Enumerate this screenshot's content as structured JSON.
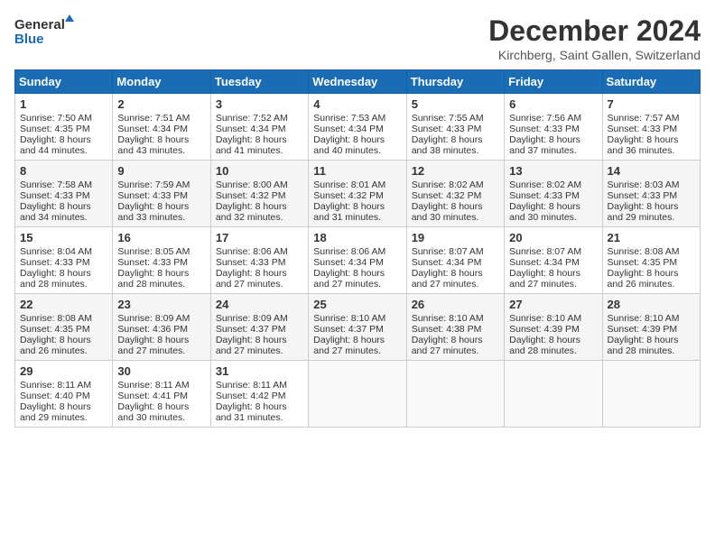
{
  "header": {
    "logo_line1": "General",
    "logo_line2": "Blue",
    "month_title": "December 2024",
    "location": "Kirchberg, Saint Gallen, Switzerland"
  },
  "days_of_week": [
    "Sunday",
    "Monday",
    "Tuesday",
    "Wednesday",
    "Thursday",
    "Friday",
    "Saturday"
  ],
  "weeks": [
    [
      {
        "day": "1",
        "sunrise": "Sunrise: 7:50 AM",
        "sunset": "Sunset: 4:35 PM",
        "daylight": "Daylight: 8 hours and 44 minutes."
      },
      {
        "day": "2",
        "sunrise": "Sunrise: 7:51 AM",
        "sunset": "Sunset: 4:34 PM",
        "daylight": "Daylight: 8 hours and 43 minutes."
      },
      {
        "day": "3",
        "sunrise": "Sunrise: 7:52 AM",
        "sunset": "Sunset: 4:34 PM",
        "daylight": "Daylight: 8 hours and 41 minutes."
      },
      {
        "day": "4",
        "sunrise": "Sunrise: 7:53 AM",
        "sunset": "Sunset: 4:34 PM",
        "daylight": "Daylight: 8 hours and 40 minutes."
      },
      {
        "day": "5",
        "sunrise": "Sunrise: 7:55 AM",
        "sunset": "Sunset: 4:33 PM",
        "daylight": "Daylight: 8 hours and 38 minutes."
      },
      {
        "day": "6",
        "sunrise": "Sunrise: 7:56 AM",
        "sunset": "Sunset: 4:33 PM",
        "daylight": "Daylight: 8 hours and 37 minutes."
      },
      {
        "day": "7",
        "sunrise": "Sunrise: 7:57 AM",
        "sunset": "Sunset: 4:33 PM",
        "daylight": "Daylight: 8 hours and 36 minutes."
      }
    ],
    [
      {
        "day": "8",
        "sunrise": "Sunrise: 7:58 AM",
        "sunset": "Sunset: 4:33 PM",
        "daylight": "Daylight: 8 hours and 34 minutes."
      },
      {
        "day": "9",
        "sunrise": "Sunrise: 7:59 AM",
        "sunset": "Sunset: 4:33 PM",
        "daylight": "Daylight: 8 hours and 33 minutes."
      },
      {
        "day": "10",
        "sunrise": "Sunrise: 8:00 AM",
        "sunset": "Sunset: 4:32 PM",
        "daylight": "Daylight: 8 hours and 32 minutes."
      },
      {
        "day": "11",
        "sunrise": "Sunrise: 8:01 AM",
        "sunset": "Sunset: 4:32 PM",
        "daylight": "Daylight: 8 hours and 31 minutes."
      },
      {
        "day": "12",
        "sunrise": "Sunrise: 8:02 AM",
        "sunset": "Sunset: 4:32 PM",
        "daylight": "Daylight: 8 hours and 30 minutes."
      },
      {
        "day": "13",
        "sunrise": "Sunrise: 8:02 AM",
        "sunset": "Sunset: 4:33 PM",
        "daylight": "Daylight: 8 hours and 30 minutes."
      },
      {
        "day": "14",
        "sunrise": "Sunrise: 8:03 AM",
        "sunset": "Sunset: 4:33 PM",
        "daylight": "Daylight: 8 hours and 29 minutes."
      }
    ],
    [
      {
        "day": "15",
        "sunrise": "Sunrise: 8:04 AM",
        "sunset": "Sunset: 4:33 PM",
        "daylight": "Daylight: 8 hours and 28 minutes."
      },
      {
        "day": "16",
        "sunrise": "Sunrise: 8:05 AM",
        "sunset": "Sunset: 4:33 PM",
        "daylight": "Daylight: 8 hours and 28 minutes."
      },
      {
        "day": "17",
        "sunrise": "Sunrise: 8:06 AM",
        "sunset": "Sunset: 4:33 PM",
        "daylight": "Daylight: 8 hours and 27 minutes."
      },
      {
        "day": "18",
        "sunrise": "Sunrise: 8:06 AM",
        "sunset": "Sunset: 4:34 PM",
        "daylight": "Daylight: 8 hours and 27 minutes."
      },
      {
        "day": "19",
        "sunrise": "Sunrise: 8:07 AM",
        "sunset": "Sunset: 4:34 PM",
        "daylight": "Daylight: 8 hours and 27 minutes."
      },
      {
        "day": "20",
        "sunrise": "Sunrise: 8:07 AM",
        "sunset": "Sunset: 4:34 PM",
        "daylight": "Daylight: 8 hours and 27 minutes."
      },
      {
        "day": "21",
        "sunrise": "Sunrise: 8:08 AM",
        "sunset": "Sunset: 4:35 PM",
        "daylight": "Daylight: 8 hours and 26 minutes."
      }
    ],
    [
      {
        "day": "22",
        "sunrise": "Sunrise: 8:08 AM",
        "sunset": "Sunset: 4:35 PM",
        "daylight": "Daylight: 8 hours and 26 minutes."
      },
      {
        "day": "23",
        "sunrise": "Sunrise: 8:09 AM",
        "sunset": "Sunset: 4:36 PM",
        "daylight": "Daylight: 8 hours and 27 minutes."
      },
      {
        "day": "24",
        "sunrise": "Sunrise: 8:09 AM",
        "sunset": "Sunset: 4:37 PM",
        "daylight": "Daylight: 8 hours and 27 minutes."
      },
      {
        "day": "25",
        "sunrise": "Sunrise: 8:10 AM",
        "sunset": "Sunset: 4:37 PM",
        "daylight": "Daylight: 8 hours and 27 minutes."
      },
      {
        "day": "26",
        "sunrise": "Sunrise: 8:10 AM",
        "sunset": "Sunset: 4:38 PM",
        "daylight": "Daylight: 8 hours and 27 minutes."
      },
      {
        "day": "27",
        "sunrise": "Sunrise: 8:10 AM",
        "sunset": "Sunset: 4:39 PM",
        "daylight": "Daylight: 8 hours and 28 minutes."
      },
      {
        "day": "28",
        "sunrise": "Sunrise: 8:10 AM",
        "sunset": "Sunset: 4:39 PM",
        "daylight": "Daylight: 8 hours and 28 minutes."
      }
    ],
    [
      {
        "day": "29",
        "sunrise": "Sunrise: 8:11 AM",
        "sunset": "Sunset: 4:40 PM",
        "daylight": "Daylight: 8 hours and 29 minutes."
      },
      {
        "day": "30",
        "sunrise": "Sunrise: 8:11 AM",
        "sunset": "Sunset: 4:41 PM",
        "daylight": "Daylight: 8 hours and 30 minutes."
      },
      {
        "day": "31",
        "sunrise": "Sunrise: 8:11 AM",
        "sunset": "Sunset: 4:42 PM",
        "daylight": "Daylight: 8 hours and 31 minutes."
      },
      null,
      null,
      null,
      null
    ]
  ]
}
